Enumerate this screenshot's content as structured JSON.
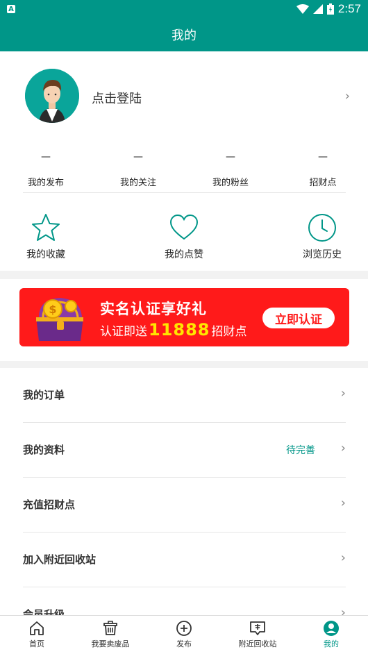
{
  "status_bar": {
    "time": "2:57"
  },
  "header": {
    "title": "我的"
  },
  "profile": {
    "login_label": "点击登陆"
  },
  "stats": [
    {
      "value": "—",
      "label": "我的发布"
    },
    {
      "value": "—",
      "label": "我的关注"
    },
    {
      "value": "—",
      "label": "我的粉丝"
    },
    {
      "value": "—",
      "label": "招财点"
    }
  ],
  "quick_actions": [
    {
      "label": "我的收藏",
      "icon": "star-icon"
    },
    {
      "label": "我的点赞",
      "icon": "heart-icon"
    },
    {
      "label": "浏览历史",
      "icon": "clock-icon"
    }
  ],
  "banner": {
    "headline": "实名认证享好礼",
    "sub_prefix": "认证即送",
    "sub_number": "11888",
    "sub_suffix": "招财点",
    "cta": "立即认证"
  },
  "menu": [
    {
      "label": "我的订单",
      "status": ""
    },
    {
      "label": "我的资料",
      "status": "待完善"
    },
    {
      "label": "充值招财点",
      "status": ""
    },
    {
      "label": "加入附近回收站",
      "status": ""
    },
    {
      "label": "会员升级",
      "status": ""
    }
  ],
  "tabs": [
    {
      "label": "首页",
      "icon": "home-icon"
    },
    {
      "label": "我要卖废品",
      "icon": "trash-icon"
    },
    {
      "label": "发布",
      "icon": "plus-circle-icon"
    },
    {
      "label": "附近回收站",
      "icon": "station-icon"
    },
    {
      "label": "我的",
      "icon": "user-icon"
    }
  ],
  "colors": {
    "primary": "#009688",
    "banner": "#ff1a1a",
    "highlight": "#ffe600"
  }
}
